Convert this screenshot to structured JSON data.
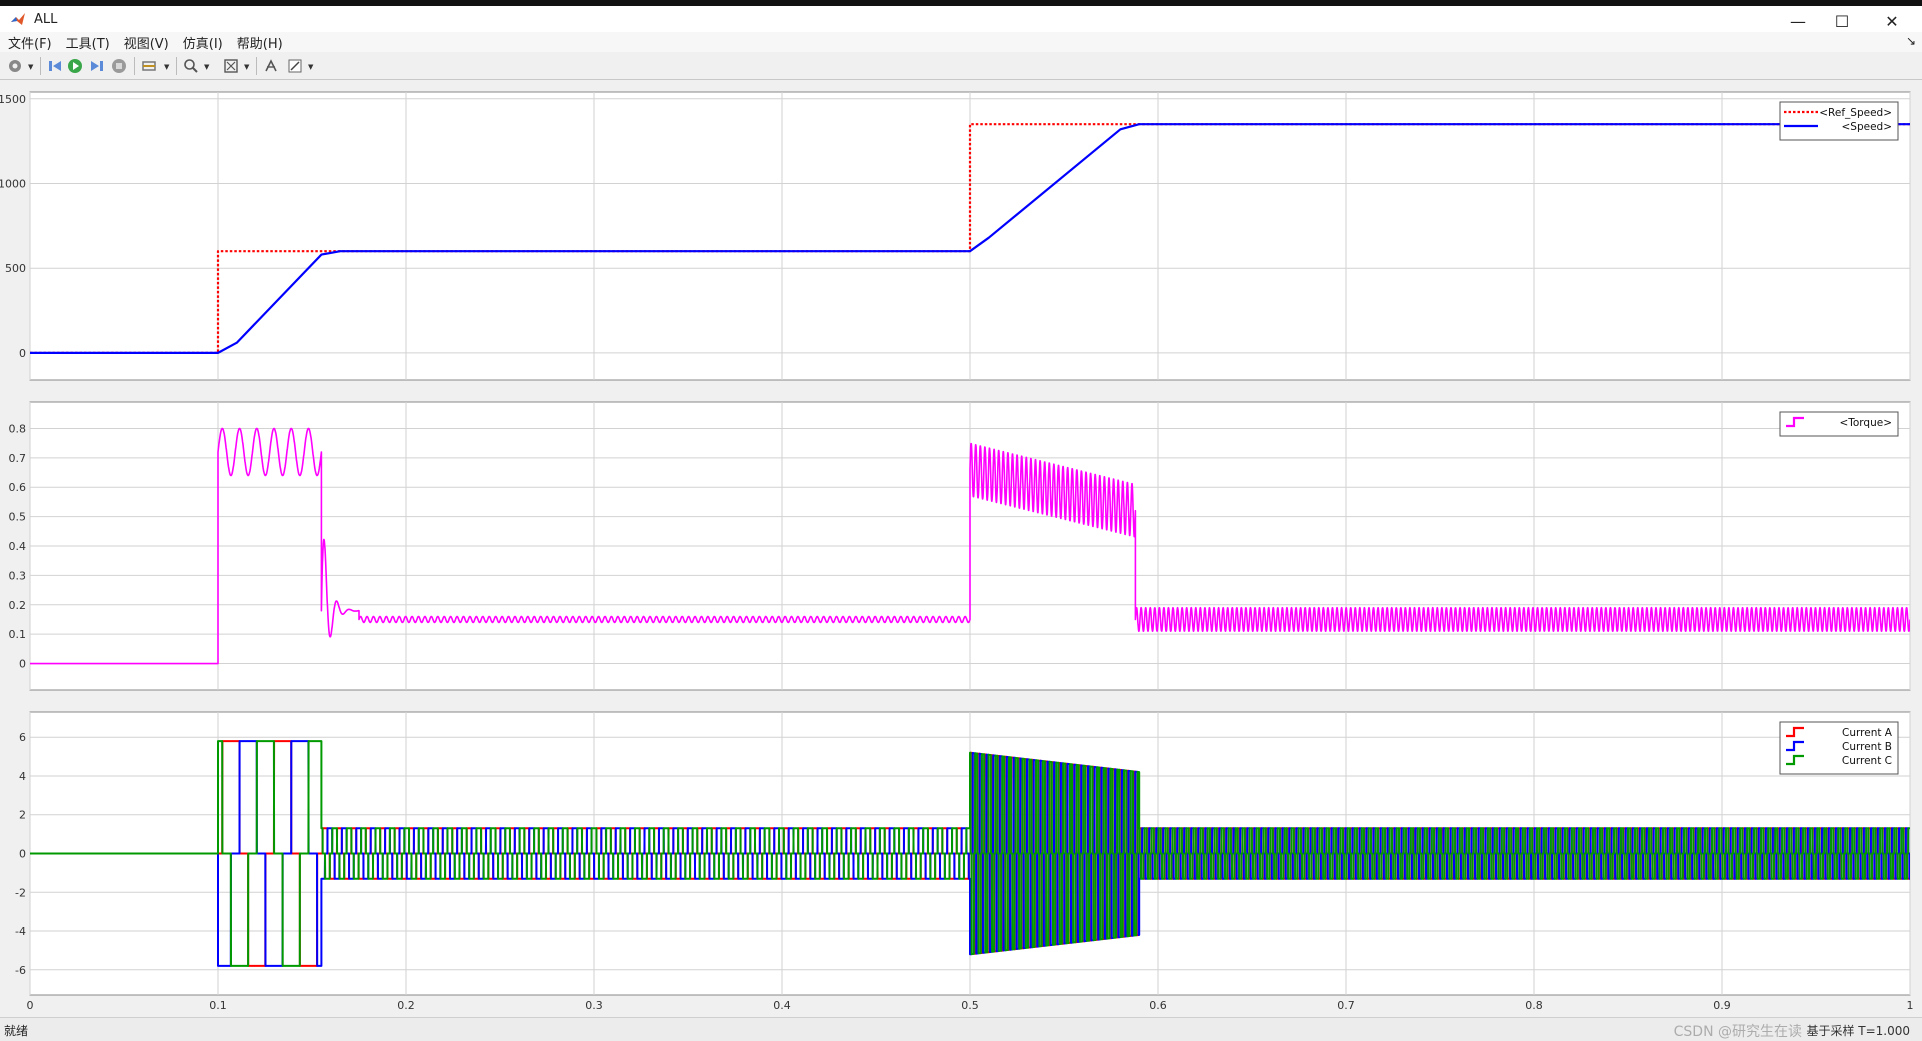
{
  "window": {
    "title": "ALL",
    "minimize": "—",
    "maximize": "☐",
    "close": "✕"
  },
  "menu": [
    "文件(F)",
    "工具(T)",
    "视图(V)",
    "仿真(I)",
    "帮助(H)"
  ],
  "menu_overflow": "↘",
  "toolbar": {
    "icons": [
      "settings-icon",
      "step-back-icon",
      "run-icon",
      "step-forward-icon",
      "stop-icon",
      "highlight-icon",
      "zoom-icon",
      "fit-to-view-icon",
      "data-cursor-icon",
      "style-icon"
    ]
  },
  "statusbar": {
    "status": "就绪",
    "sample": "基于采样  T=1.000",
    "watermark": "CSDN @研究生在读"
  },
  "chart_data": [
    {
      "type": "line",
      "title": "",
      "xlim": [
        0,
        1
      ],
      "ylim": [
        -160,
        1540
      ],
      "yticks": [
        0,
        500,
        1000,
        1500
      ],
      "grid": true,
      "legend_position": "top-right",
      "series": [
        {
          "name": "<Ref_Speed>",
          "color": "#ff0000",
          "style": "dotted",
          "x": [
            0,
            0.1,
            0.1,
            0.5,
            0.5,
            1.0
          ],
          "y": [
            0,
            0,
            600,
            600,
            1350,
            1350
          ]
        },
        {
          "name": "<Speed>",
          "color": "#0000ff",
          "style": "solid",
          "x": [
            0,
            0.1,
            0.11,
            0.155,
            0.165,
            0.5,
            0.51,
            0.58,
            0.59,
            1.0
          ],
          "y": [
            0,
            0,
            60,
            580,
            600,
            600,
            680,
            1320,
            1350,
            1350
          ]
        }
      ]
    },
    {
      "type": "line",
      "title": "",
      "xlim": [
        0,
        1
      ],
      "ylim": [
        -0.09,
        0.89
      ],
      "yticks": [
        0,
        0.1,
        0.2,
        0.3,
        0.4,
        0.5,
        0.6,
        0.7,
        0.8
      ],
      "grid": true,
      "legend_position": "top-right",
      "series": [
        {
          "name": "<Torque>",
          "color": "#ff00ff",
          "segments": [
            {
              "t": [
                0,
                0.1
              ],
              "level": 0
            },
            {
              "t": [
                0.1,
                0.155
              ],
              "level": 0.72,
              "ripple": 0.08,
              "cycles": 6
            },
            {
              "t": [
                0.155,
                0.175
              ],
              "level": 0.18,
              "transient": [
                0.38,
                0.06
              ]
            },
            {
              "t": [
                0.175,
                0.5
              ],
              "level": 0.15,
              "ripple": 0.01,
              "cycles": 95
            },
            {
              "t": [
                0.5,
                0.588
              ],
              "level_start": 0.66,
              "level_end": 0.52,
              "ripple": 0.09,
              "cycles": 36
            },
            {
              "t": [
                0.588,
                1.0
              ],
              "level": 0.15,
              "ripple": 0.04,
              "cycles": 170
            }
          ]
        }
      ]
    },
    {
      "type": "line",
      "title": "",
      "xlim": [
        0,
        1
      ],
      "ylim": [
        -7.3,
        7.3
      ],
      "yticks": [
        -6,
        -4,
        -2,
        0,
        2,
        4,
        6
      ],
      "grid": true,
      "legend_position": "top-right",
      "series": [
        {
          "name": "Current  A",
          "color": "#ff0000"
        },
        {
          "name": "Current B",
          "color": "#0000ff"
        },
        {
          "name": "Current C",
          "color": "#009900"
        }
      ],
      "segments": [
        {
          "t": [
            0,
            0.1
          ],
          "amplitude": 0
        },
        {
          "t": [
            0.1,
            0.155
          ],
          "amplitude": 5.8,
          "cycles": 2
        },
        {
          "t": [
            0.155,
            0.5
          ],
          "amplitude": 1.3,
          "cycles": 45
        },
        {
          "t": [
            0.5,
            0.59
          ],
          "amplitude_start": 5.2,
          "amplitude_end": 4.2,
          "cycles": 25
        },
        {
          "t": [
            0.59,
            1.0
          ],
          "amplitude": 1.3,
          "cycles": 110
        }
      ]
    }
  ],
  "x_axis": {
    "ticks": [
      "0",
      "0.1",
      "0.2",
      "0.3",
      "0.4",
      "0.5",
      "0.6",
      "0.7",
      "0.8",
      "0.9",
      "1"
    ]
  }
}
